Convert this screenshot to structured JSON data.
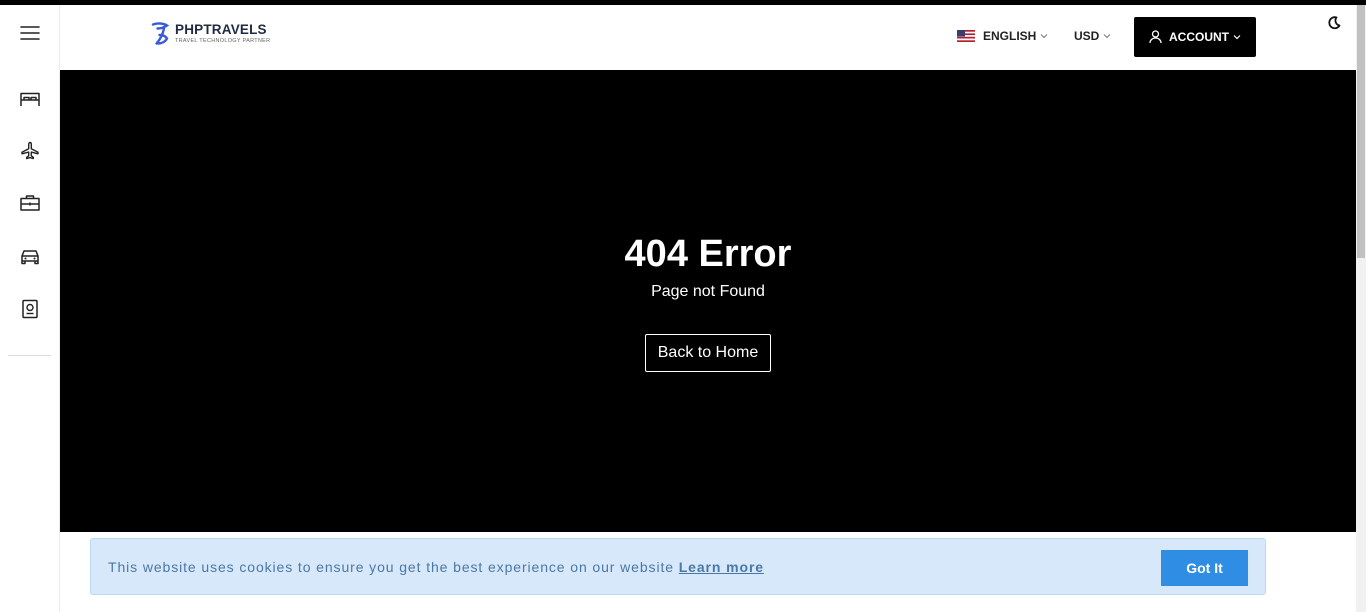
{
  "header": {
    "logo_name": "PHPTRAVELS",
    "logo_tagline": "TRAVEL TECHNOLOGY PARTNER",
    "language": "ENGLISH",
    "currency": "USD",
    "account_label": "ACCOUNT"
  },
  "sidebar": {
    "items": [
      {
        "icon": "bed-icon",
        "target": "hotels"
      },
      {
        "icon": "plane-icon",
        "target": "flights"
      },
      {
        "icon": "briefcase-icon",
        "target": "tours"
      },
      {
        "icon": "car-icon",
        "target": "cars"
      },
      {
        "icon": "passport-icon",
        "target": "visa"
      }
    ]
  },
  "error": {
    "title": "404 Error",
    "subtitle": "Page not Found",
    "button_label": "Back to Home"
  },
  "cookie": {
    "message": "This website uses cookies to ensure you get the best experience on our website",
    "link_label": "Learn more",
    "button_label": "Got It"
  },
  "colors": {
    "hero_bg": "#000000",
    "cookie_bg": "#d8e8fb",
    "cookie_text": "#4a78a6",
    "got_it_bg": "#2f8de4",
    "account_bg": "#000000"
  }
}
